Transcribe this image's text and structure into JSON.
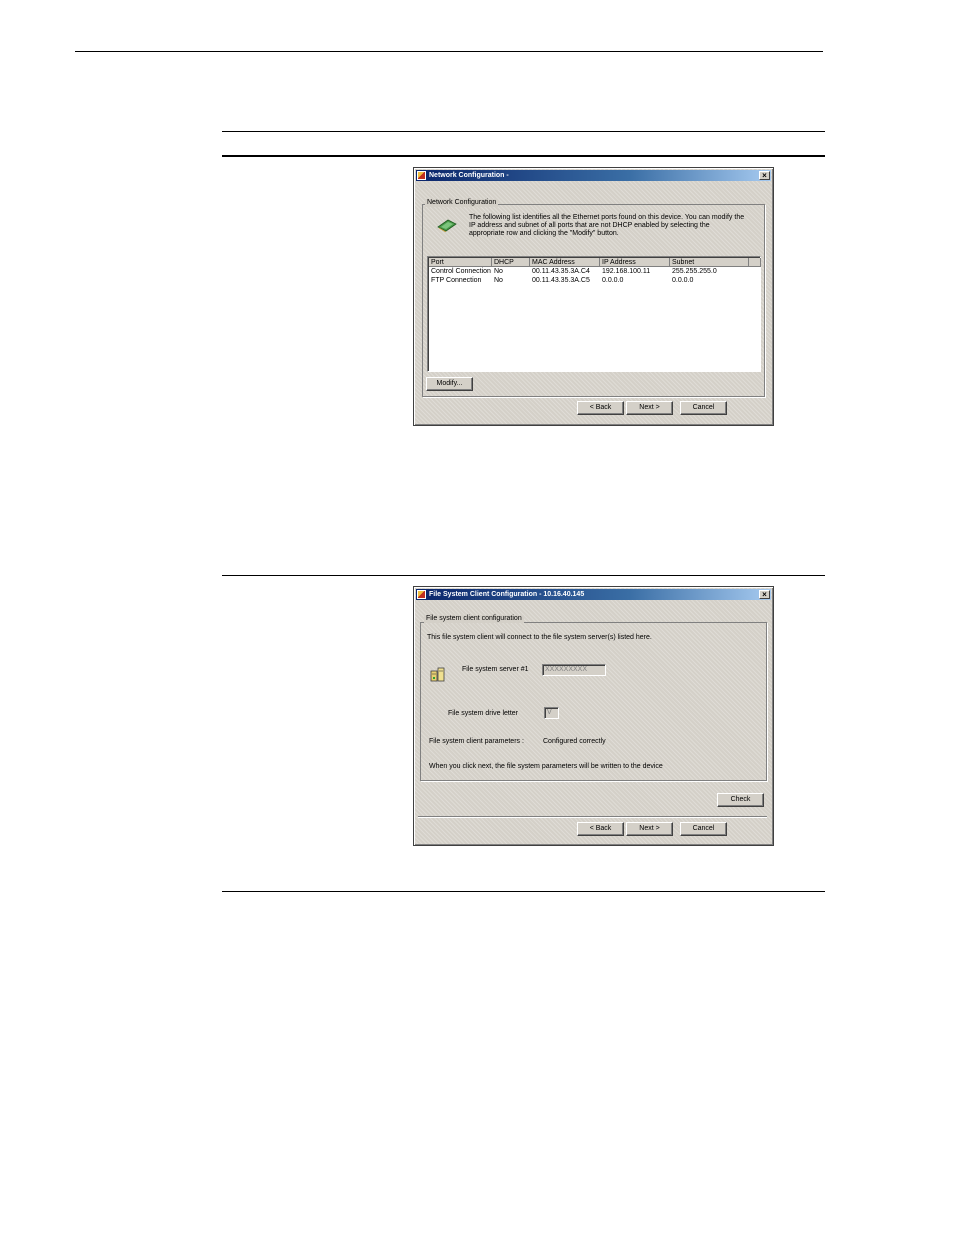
{
  "network_dialog": {
    "title": "Network Configuration -",
    "close_symbol": "×",
    "group_label": "Network Configuration",
    "description_lines": [
      "The following list identifies all the Ethernet ports found on this device. You can modify the",
      "IP address and subnet of all ports that are not DHCP enabled by selecting the",
      "appropriate row and clicking the \"Modify\" button."
    ],
    "icon": "network-card-icon",
    "columns": [
      "Port",
      "DHCP",
      "MAC Address",
      "IP Address",
      "Subnet"
    ],
    "rows": [
      [
        "Control Connection",
        "No",
        "00.11.43.35.3A.C4",
        "192.168.100.11",
        "255.255.255.0"
      ],
      [
        "FTP Connection",
        "No",
        "00.11.43.35.3A.C5",
        "0.0.0.0",
        "0.0.0.0"
      ]
    ],
    "modify_button": "Modify...",
    "back_button": "< Back",
    "next_button": "Next >",
    "cancel_button": "Cancel"
  },
  "fs_dialog": {
    "title": "File System Client Configuration - 10.16.40.145",
    "close_symbol": "×",
    "group_label": "File system client configuration",
    "intro": "This file system client will connect to the file system server(s) listed here.",
    "icon": "file-server-icon",
    "server_label": "File system server #1",
    "server_value": "XXXXXXXXX",
    "drive_label": "File system drive letter",
    "drive_value": "V",
    "params_label": "File system client parameters :",
    "params_value": "Configured correctly",
    "footer_text": "When you click next, the file system parameters will be written to the device",
    "check_button": "Check",
    "back_button": "< Back",
    "next_button": "Next >",
    "cancel_button": "Cancel"
  }
}
